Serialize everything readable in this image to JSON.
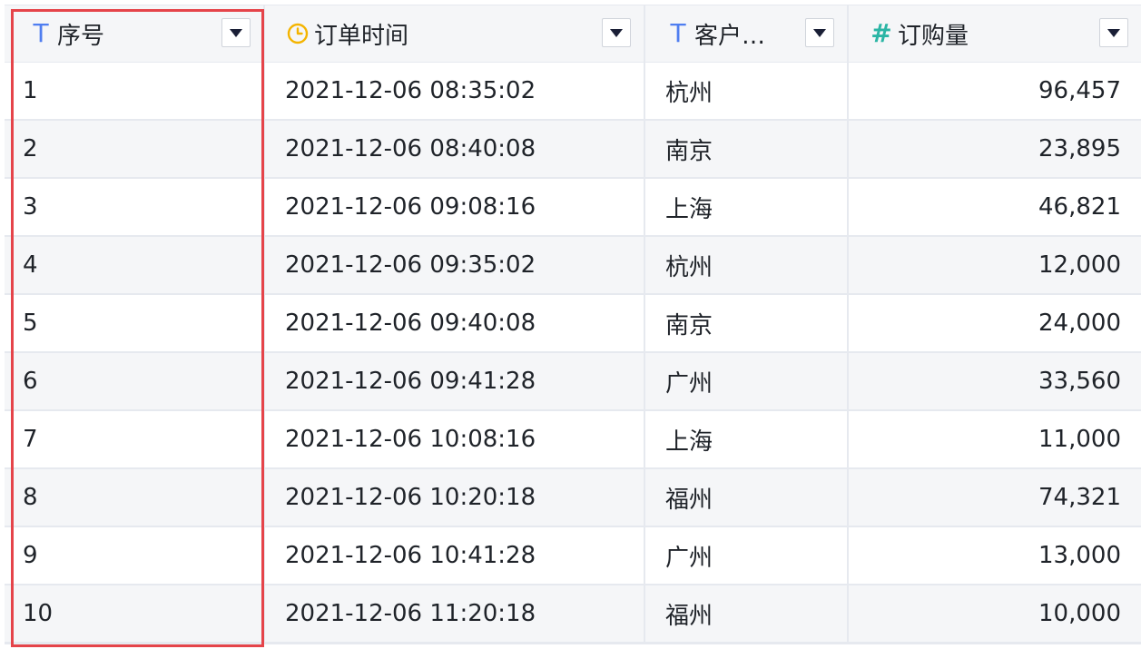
{
  "columns": [
    {
      "label": "序号",
      "type": "text",
      "icon": "text-type-icon"
    },
    {
      "label": "订单时间",
      "type": "time",
      "icon": "clock-icon"
    },
    {
      "label": "客户…",
      "type": "text",
      "icon": "text-type-icon"
    },
    {
      "label": "订购量",
      "type": "number",
      "icon": "hash-icon"
    }
  ],
  "icon_glyphs": {
    "text": "T",
    "number": "#"
  },
  "colors": {
    "text_icon": "#4f7ef0",
    "number_icon": "#2bb5a5",
    "time_icon": "#f4b400",
    "highlight_border": "#e5444a",
    "header_bg": "#f5f6f8",
    "row_alt_bg": "#f5f6f8"
  },
  "highlighted_column": "序号",
  "rows": [
    {
      "id": "1",
      "time": "2021-12-06 08:35:02",
      "city": "杭州",
      "qty": "96,457"
    },
    {
      "id": "2",
      "time": "2021-12-06 08:40:08",
      "city": "南京",
      "qty": "23,895"
    },
    {
      "id": "3",
      "time": "2021-12-06 09:08:16",
      "city": "上海",
      "qty": "46,821"
    },
    {
      "id": "4",
      "time": "2021-12-06 09:35:02",
      "city": "杭州",
      "qty": "12,000"
    },
    {
      "id": "5",
      "time": "2021-12-06 09:40:08",
      "city": "南京",
      "qty": "24,000"
    },
    {
      "id": "6",
      "time": "2021-12-06 09:41:28",
      "city": "广州",
      "qty": "33,560"
    },
    {
      "id": "7",
      "time": "2021-12-06 10:08:16",
      "city": "上海",
      "qty": "11,000"
    },
    {
      "id": "8",
      "time": "2021-12-06 10:20:18",
      "city": "福州",
      "qty": "74,321"
    },
    {
      "id": "9",
      "time": "2021-12-06 10:41:28",
      "city": "广州",
      "qty": "13,000"
    },
    {
      "id": "10",
      "time": "2021-12-06 11:20:18",
      "city": "福州",
      "qty": "10,000"
    }
  ]
}
